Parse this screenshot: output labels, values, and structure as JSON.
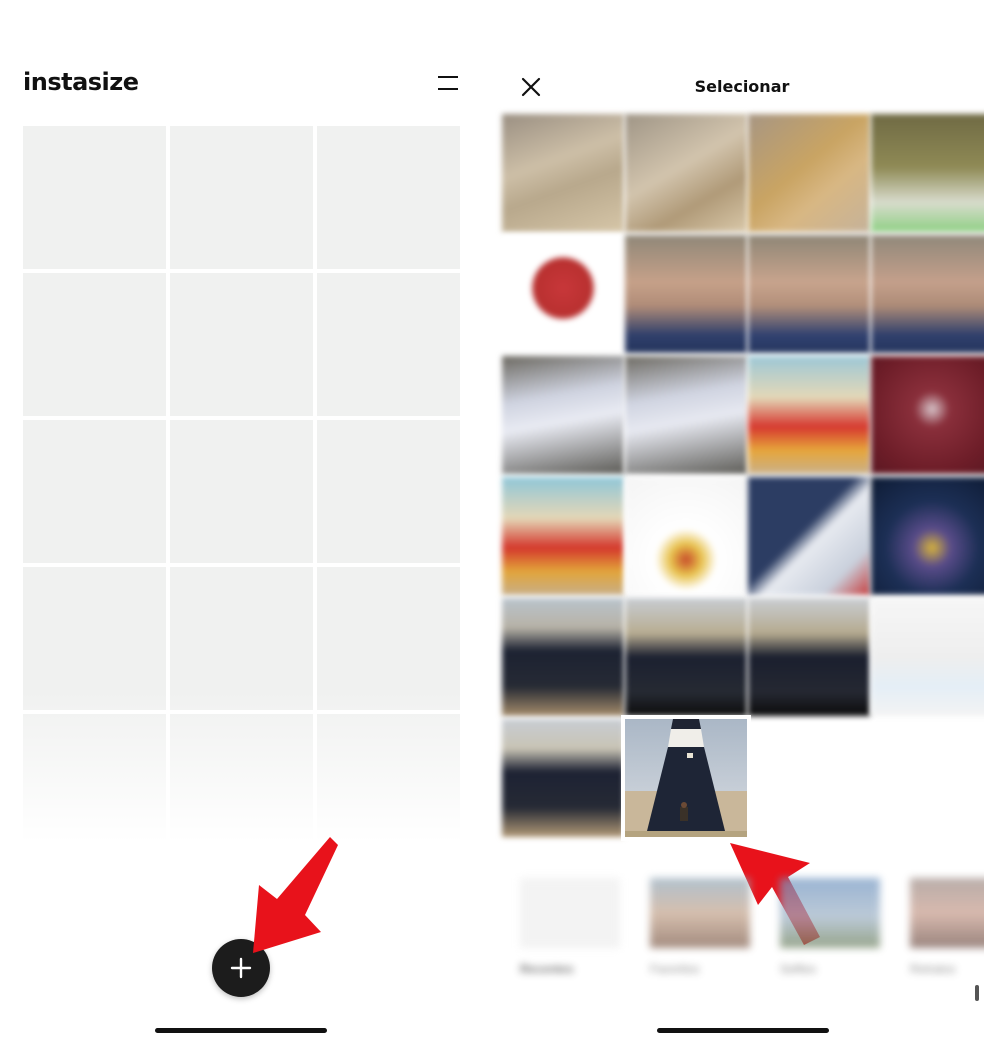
{
  "left_screen": {
    "app_logo": "instasize",
    "menu_icon": "menu-icon",
    "grid_cells": 15,
    "fab_icon": "plus-icon",
    "fab_symbol": "+"
  },
  "right_screen": {
    "close_icon": "close-icon",
    "title": "Selecionar",
    "photo_grid": {
      "columns": 4,
      "total_photos": 22,
      "selected_index": 21
    },
    "albums": [
      {
        "label": "Recentes"
      },
      {
        "label": "Favoritos"
      },
      {
        "label": "Selfies"
      },
      {
        "label": "Retratos"
      }
    ]
  },
  "annotations": {
    "arrow_color": "#e8121b",
    "arrow_count": 2
  },
  "colors": {
    "fab_background": "#1c1c1c",
    "grid_cell": "#f0f1f0",
    "text": "#111111"
  }
}
